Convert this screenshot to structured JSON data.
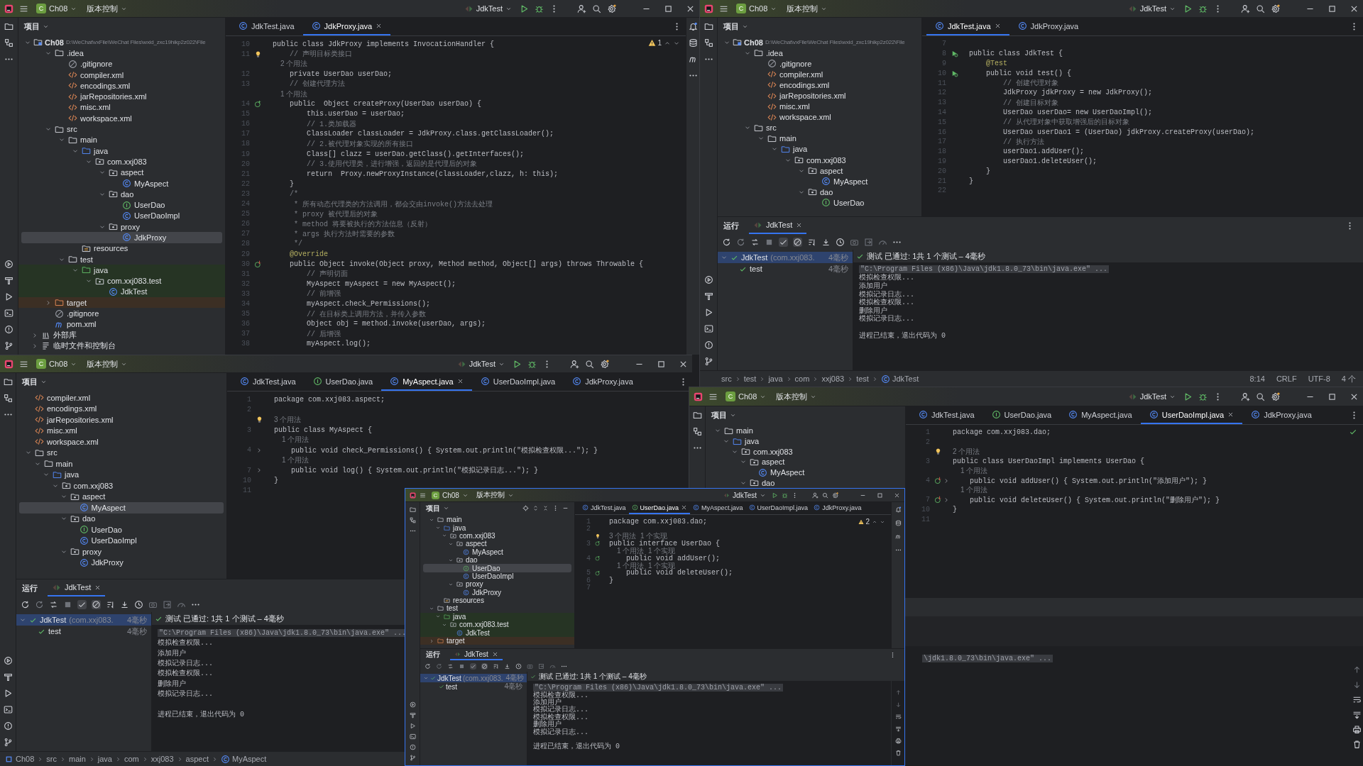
{
  "windows": [
    {
      "title_bar": {
        "badge": "C",
        "project": "Ch08",
        "vcs": "版本控制",
        "run_config": "JdkTest"
      },
      "project_pane": {
        "title": "项目",
        "tree": [
          {
            "label": "Ch08",
            "kind": "module",
            "path": "D:\\WeChat\\vxFile\\WeChat Files\\wxid_zxc19hikp2z022\\File",
            "expanded": true,
            "selected": false,
            "children": [
              {
                "label": ".idea",
                "kind": "folder",
                "expanded": true,
                "selected": false,
                "children": [
                  {
                    "label": ".gitignore",
                    "kind": "ignore",
                    "selected": false
                  },
                  {
                    "label": "compiler.xml",
                    "kind": "xml",
                    "selected": false
                  },
                  {
                    "label": "encodings.xml",
                    "kind": "xml",
                    "selected": false
                  },
                  {
                    "label": "jarRepositories.xml",
                    "kind": "xml",
                    "selected": false
                  },
                  {
                    "label": "misc.xml",
                    "kind": "xml",
                    "selected": false
                  },
                  {
                    "label": "workspace.xml",
                    "kind": "xml",
                    "selected": false
                  }
                ]
              },
              {
                "label": "src",
                "kind": "folder",
                "expanded": true,
                "selected": false,
                "children": [
                  {
                    "label": "main",
                    "kind": "folder",
                    "expanded": true,
                    "selected": false,
                    "children": [
                      {
                        "label": "java",
                        "kind": "source",
                        "expanded": true,
                        "selected": false,
                        "children": [
                          {
                            "label": "com.xxj083",
                            "kind": "package",
                            "expanded": true,
                            "selected": false,
                            "children": [
                              {
                                "label": "aspect",
                                "kind": "package",
                                "expanded": true,
                                "selected": false,
                                "children": [
                                  {
                                    "label": "MyAspect",
                                    "kind": "class",
                                    "selected": false
                                  }
                                ]
                              },
                              {
                                "label": "dao",
                                "kind": "package",
                                "expanded": true,
                                "selected": false,
                                "children": [
                                  {
                                    "label": "UserDao",
                                    "kind": "interface",
                                    "selected": false
                                  },
                                  {
                                    "label": "UserDaoImpl",
                                    "kind": "class",
                                    "selected": false
                                  }
                                ]
                              },
                              {
                                "label": "proxy",
                                "kind": "package",
                                "expanded": true,
                                "selected": false,
                                "children": [
                                  {
                                    "label": "JdkProxy",
                                    "kind": "class",
                                    "selected": true
                                  }
                                ]
                              }
                            ]
                          }
                        ]
                      },
                      {
                        "label": "resources",
                        "kind": "resources",
                        "selected": false
                      }
                    ]
                  },
                  {
                    "label": "test",
                    "kind": "folder",
                    "expanded": true,
                    "selected": false,
                    "children": [
                      {
                        "label": "java",
                        "kind": "test_source",
                        "expanded": true,
                        "selected": false,
                        "children": [
                          {
                            "label": "com.xxj083.test",
                            "kind": "package",
                            "expanded": true,
                            "selected": false,
                            "children": [
                              {
                                "label": "JdkTest",
                                "kind": "class",
                                "selected": false
                              }
                            ]
                          }
                        ]
                      }
                    ]
                  }
                ]
              },
              {
                "label": "target",
                "kind": "excluded",
                "expanded": false,
                "selected": false
              },
              {
                "label": ".gitignore",
                "kind": "ignore",
                "selected": false
              },
              {
                "label": "pom.xml",
                "kind": "maven",
                "selected": false
              }
            ]
          },
          {
            "label": "外部库",
            "kind": "library",
            "expanded": false,
            "selected": false
          },
          {
            "label": "临时文件和控制台",
            "kind": "scratch",
            "expanded": false,
            "selected": false
          }
        ]
      },
      "editor": {
        "tabs": [
          {
            "label": "JdkTest.java",
            "kind": "class",
            "selected": false
          },
          {
            "label": "JdkProxy.java",
            "kind": "class",
            "selected": true
          }
        ],
        "inspection": {
          "kind": "warning",
          "count": "1"
        },
        "lines": [
          {
            "number": "10",
            "kind": "code",
            "text": "public class JdkProxy implements InvocationHandler {"
          },
          {
            "number": "11",
            "kind": "comment",
            "text": "    // 声明目标类接口",
            "gutter": {
              "kind": "bulb"
            }
          },
          {
            "kind": "hint",
            "text": "    2 个用法"
          },
          {
            "number": "12",
            "kind": "code",
            "text": "    private UserDao userDao;"
          },
          {
            "number": "13",
            "kind": "comment",
            "text": "    // 创建代理方法"
          },
          {
            "kind": "hint",
            "text": "    1 个用法"
          },
          {
            "number": "14",
            "kind": "code",
            "text": "    public  Object createProxy(UserDao userDao) {",
            "gutter": {
              "kind": "implemented"
            }
          },
          {
            "number": "15",
            "kind": "code",
            "text": "        this.userDao = userDao;"
          },
          {
            "number": "16",
            "kind": "comment",
            "text": "        // 1.类加载器"
          },
          {
            "number": "17",
            "kind": "code",
            "text": "        ClassLoader classLoader = JdkProxy.class.getClassLoader();"
          },
          {
            "number": "18",
            "kind": "comment",
            "text": "        // 2.被代理对象实现的所有接口"
          },
          {
            "number": "19",
            "kind": "code",
            "text": "        Class[] clazz = userDao.getClass().getInterfaces();"
          },
          {
            "number": "20",
            "kind": "comment",
            "text": "        // 3.使用代理类，进行增强，返回的是代理后的对象"
          },
          {
            "number": "21",
            "kind": "code",
            "text": "        return  Proxy.newProxyInstance(classLoader,clazz, h: this);"
          },
          {
            "number": "22",
            "kind": "code",
            "text": "    }"
          },
          {
            "number": "23",
            "kind": "comment",
            "text": "    /*"
          },
          {
            "number": "24",
            "kind": "comment",
            "text": "     * 所有动态代理类的方法调用，都会交由invoke()方法去处理"
          },
          {
            "number": "25",
            "kind": "comment",
            "text": "     * proxy 被代理后的对象"
          },
          {
            "number": "26",
            "kind": "comment",
            "text": "     * method 将要被执行的方法信息（反射）"
          },
          {
            "number": "27",
            "kind": "comment",
            "text": "     * args 执行方法时需要的参数"
          },
          {
            "number": "28",
            "kind": "comment",
            "text": "     */"
          },
          {
            "number": "29",
            "kind": "annotation",
            "text": "    @Override"
          },
          {
            "number": "30",
            "kind": "code",
            "text": "    public Object invoke(Object proxy, Method method, Object[] args) throws Throwable {",
            "gutter": {
              "kind": "overriding"
            }
          },
          {
            "number": "31",
            "kind": "comment",
            "text": "        // 声明切面"
          },
          {
            "number": "32",
            "kind": "code",
            "text": "        MyAspect myAspect = new MyAspect();"
          },
          {
            "number": "33",
            "kind": "comment",
            "text": "        // 前增强"
          },
          {
            "number": "34",
            "kind": "code",
            "text": "        myAspect.check_Permissions();"
          },
          {
            "number": "35",
            "kind": "comment",
            "text": "        // 在目标类上调用方法，并传入参数"
          },
          {
            "number": "36",
            "kind": "code",
            "text": "        Object obj = method.invoke(userDao, args);"
          },
          {
            "number": "37",
            "kind": "comment",
            "text": "        // 后增强"
          },
          {
            "number": "38",
            "kind": "code",
            "text": "        myAspect.log();"
          }
        ]
      }
    },
    {
      "title_bar": {
        "badge": "C",
        "project": "Ch08",
        "vcs": "版本控制",
        "run_config": "JdkTest"
      },
      "project_pane": {
        "title": "项目",
        "tree": [
          {
            "label": "Ch08",
            "kind": "module",
            "path": "D:\\WeChat\\vxFile\\WeChat Files\\wxid_zxc19hikp2z022\\File",
            "expanded": true,
            "selected": false,
            "children": [
              {
                "label": ".idea",
                "kind": "folder",
                "expanded": true,
                "selected": false,
                "children": [
                  {
                    "label": ".gitignore",
                    "kind": "ignore",
                    "selected": false
                  },
                  {
                    "label": "compiler.xml",
                    "kind": "xml",
                    "selected": false
                  },
                  {
                    "label": "encodings.xml",
                    "kind": "xml",
                    "selected": false
                  },
                  {
                    "label": "jarRepositories.xml",
                    "kind": "xml",
                    "selected": false
                  },
                  {
                    "label": "misc.xml",
                    "kind": "xml",
                    "selected": false
                  },
                  {
                    "label": "workspace.xml",
                    "kind": "xml",
                    "selected": false
                  }
                ]
              },
              {
                "label": "src",
                "kind": "folder",
                "expanded": true,
                "selected": false,
                "children": [
                  {
                    "label": "main",
                    "kind": "folder",
                    "expanded": true,
                    "selected": false,
                    "children": [
                      {
                        "label": "java",
                        "kind": "source",
                        "expanded": true,
                        "selected": false,
                        "children": [
                          {
                            "label": "com.xxj083",
                            "kind": "package",
                            "expanded": true,
                            "selected": false,
                            "children": [
                              {
                                "label": "aspect",
                                "kind": "package",
                                "expanded": true,
                                "selected": false,
                                "children": [
                                  {
                                    "label": "MyAspect",
                                    "kind": "class",
                                    "selected": false
                                  }
                                ]
                              },
                              {
                                "label": "dao",
                                "kind": "package",
                                "expanded": true,
                                "selected": false,
                                "children": [
                                  {
                                    "label": "UserDao",
                                    "kind": "interface",
                                    "selected": false
                                  }
                                ]
                              }
                            ]
                          }
                        ]
                      }
                    ]
                  }
                ]
              }
            ]
          }
        ]
      },
      "editor": {
        "tabs": [
          {
            "label": "JdkTest.java",
            "kind": "class",
            "selected": true
          },
          {
            "label": "JdkProxy.java",
            "kind": "class",
            "selected": false
          }
        ],
        "lines": [
          {
            "number": "7",
            "kind": "code"
          },
          {
            "number": "8",
            "kind": "code",
            "text": "public class JdkTest {",
            "gutter": {
              "kind": "run"
            }
          },
          {
            "number": "9",
            "kind": "annotation",
            "text": "    @Test"
          },
          {
            "number": "10",
            "kind": "code",
            "text": "    public void test() {",
            "gutter": {
              "kind": "run"
            }
          },
          {
            "number": "11",
            "kind": "comment",
            "text": "        // 创建代理对象"
          },
          {
            "number": "12",
            "kind": "code",
            "text": "        JdkProxy jdkProxy = new JdkProxy();"
          },
          {
            "number": "13",
            "kind": "comment",
            "text": "        // 创建目标对象"
          },
          {
            "number": "14",
            "kind": "code",
            "text": "        UserDao userDao= new UserDaoImpl();"
          },
          {
            "number": "15",
            "kind": "comment",
            "text": "        // 从代理对象中获取增强后的目标对象"
          },
          {
            "number": "16",
            "kind": "code",
            "text": "        UserDao userDao1 = (UserDao) jdkProxy.createProxy(userDao);"
          },
          {
            "number": "17",
            "kind": "comment",
            "text": "        // 执行方法"
          },
          {
            "number": "18",
            "kind": "code",
            "text": "        userDao1.addUser();"
          },
          {
            "number": "19",
            "kind": "code",
            "text": "        userDao1.deleteUser();"
          },
          {
            "number": "20",
            "kind": "code",
            "text": "    }"
          },
          {
            "number": "21",
            "kind": "code",
            "text": "}"
          },
          {
            "number": "22",
            "kind": "code"
          }
        ]
      },
      "run_panel": {
        "title": "运行",
        "tab": {
          "label": "JdkTest",
          "selected": true
        },
        "tests": [
          {
            "name": "JdkTest",
            "detail": "(com.xxj083.",
            "time": "4毫秒",
            "passed": true,
            "expanded": true,
            "children": [
              {
                "name": "test",
                "time": "4毫秒",
                "passed": true
              }
            ]
          }
        ],
        "summary": "测试 已通过: 1共 1 个测试 – 4毫秒",
        "console": [
          {
            "kind": "command",
            "text": "\"C:\\Program Files (x86)\\Java\\jdk1.8.0_73\\bin\\java.exe\" ..."
          },
          {
            "kind": "output",
            "text": "模拟检查权限..."
          },
          {
            "kind": "output",
            "text": "添加用户"
          },
          {
            "kind": "output",
            "text": "模拟记录日志..."
          },
          {
            "kind": "output",
            "text": "模拟检查权限..."
          },
          {
            "kind": "output",
            "text": "删除用户"
          },
          {
            "kind": "output",
            "text": "模拟记录日志..."
          },
          {
            "kind": "exit",
            "text": "进程已结束，退出代码为 0"
          }
        ]
      },
      "status_bar": {
        "breadcrumbs": [
          {
            "label": "src",
            "kind": "folder"
          },
          {
            "label": "test",
            "kind": "folder"
          },
          {
            "label": "java",
            "kind": "folder"
          },
          {
            "label": "com",
            "kind": "folder"
          },
          {
            "label": "xxj083",
            "kind": "folder"
          },
          {
            "label": "test",
            "kind": "folder"
          },
          {
            "label": "JdkTest",
            "kind": "class"
          }
        ],
        "items": [
          "8:14",
          "CRLF",
          "UTF-8",
          "4 个"
        ]
      }
    },
    {
      "title_bar": {
        "badge": "C",
        "project": "Ch08",
        "vcs": "版本控制",
        "run_config": "JdkTest"
      },
      "project_pane": {
        "title": "项目",
        "tree": [
          {
            "label": "compiler.xml",
            "kind": "xml",
            "selected": false
          },
          {
            "label": "encodings.xml",
            "kind": "xml",
            "selected": false
          },
          {
            "label": "jarRepositories.xml",
            "kind": "xml",
            "selected": false
          },
          {
            "label": "misc.xml",
            "kind": "xml",
            "selected": false
          },
          {
            "label": "workspace.xml",
            "kind": "xml",
            "selected": false
          },
          {
            "label": "src",
            "kind": "folder",
            "expanded": true,
            "selected": false,
            "children": [
              {
                "label": "main",
                "kind": "folder",
                "expanded": true,
                "selected": false,
                "children": [
                  {
                    "label": "java",
                    "kind": "source",
                    "expanded": true,
                    "selected": false,
                    "children": [
                      {
                        "label": "com.xxj083",
                        "kind": "package",
                        "expanded": true,
                        "selected": false,
                        "children": [
                          {
                            "label": "aspect",
                            "kind": "package",
                            "expanded": true,
                            "selected": false,
                            "children": [
                              {
                                "label": "MyAspect",
                                "kind": "class",
                                "selected": true
                              }
                            ]
                          },
                          {
                            "label": "dao",
                            "kind": "package",
                            "expanded": true,
                            "selected": false,
                            "children": [
                              {
                                "label": "UserDao",
                                "kind": "interface",
                                "selected": false
                              },
                              {
                                "label": "UserDaoImpl",
                                "kind": "class",
                                "selected": false
                              }
                            ]
                          },
                          {
                            "label": "proxy",
                            "kind": "package",
                            "expanded": true,
                            "selected": false,
                            "children": [
                              {
                                "label": "JdkProxy",
                                "kind": "class",
                                "selected": false
                              }
                            ]
                          }
                        ]
                      }
                    ]
                  }
                ]
              }
            ]
          }
        ]
      },
      "editor": {
        "tabs": [
          {
            "label": "JdkTest.java",
            "kind": "class",
            "selected": false
          },
          {
            "label": "UserDao.java",
            "kind": "interface",
            "selected": false
          },
          {
            "label": "MyAspect.java",
            "kind": "class",
            "selected": true
          },
          {
            "label": "UserDaoImpl.java",
            "kind": "class",
            "selected": false
          },
          {
            "label": "JdkProxy.java",
            "kind": "class",
            "selected": false
          }
        ],
        "lines": [
          {
            "number": "1",
            "kind": "code",
            "text": "package com.xxj083.aspect;",
            "folded": false
          },
          {
            "number": "2",
            "kind": "code",
            "folded": false
          },
          {
            "kind": "hint",
            "text": "3 个用法",
            "gutter": {
              "kind": "bulb"
            },
            "folded": false
          },
          {
            "number": "3",
            "kind": "code",
            "text": "public class MyAspect {",
            "folded": false
          },
          {
            "kind": "hint",
            "text": "    1 个用法",
            "folded": false
          },
          {
            "number": "4",
            "kind": "code",
            "text": "    public void check_Permissions() { System.out.println(\"模拟检查权限...\"); }",
            "folded": true
          },
          {
            "kind": "hint",
            "text": "    1 个用法",
            "folded": false
          },
          {
            "number": "7",
            "kind": "code",
            "text": "    public void log() { System.out.println(\"模拟记录日志...\"); }",
            "folded": true
          },
          {
            "number": "10",
            "kind": "code",
            "text": "}",
            "folded": false
          },
          {
            "number": "11",
            "kind": "code",
            "folded": false
          }
        ]
      },
      "run_panel": {
        "title": "运行",
        "tab": {
          "label": "JdkTest",
          "selected": true
        },
        "tests": [
          {
            "name": "JdkTest",
            "detail": "(com.xxj083.",
            "time": "4毫秒",
            "passed": true,
            "expanded": true,
            "children": [
              {
                "name": "test",
                "time": "4毫秒",
                "passed": true
              }
            ]
          }
        ],
        "summary": "测试 已通过: 1共 1 个测试 – 4毫秒",
        "console": [
          {
            "kind": "command",
            "text": "\"C:\\Program Files (x86)\\Java\\jdk1.8.0_73\\bin\\java.exe\" ..."
          },
          {
            "kind": "output",
            "text": "模拟检查权限..."
          },
          {
            "kind": "output",
            "text": "添加用户"
          },
          {
            "kind": "output",
            "text": "模拟记录日志..."
          },
          {
            "kind": "output",
            "text": "模拟检查权限..."
          },
          {
            "kind": "output",
            "text": "删除用户"
          },
          {
            "kind": "output",
            "text": "模拟记录日志..."
          },
          {
            "kind": "exit",
            "text": "进程已结束，退出代码为 0"
          }
        ]
      },
      "status_bar": {
        "breadcrumbs": [
          {
            "label": "Ch08",
            "kind": "module"
          },
          {
            "label": "src",
            "kind": "folder"
          },
          {
            "label": "main",
            "kind": "folder"
          },
          {
            "label": "java",
            "kind": "folder"
          },
          {
            "label": "com",
            "kind": "folder"
          },
          {
            "label": "xxj083",
            "kind": "folder"
          },
          {
            "label": "aspect",
            "kind": "folder"
          },
          {
            "label": "MyAspect",
            "kind": "class"
          }
        ]
      }
    },
    {
      "title_bar": {
        "badge": "C",
        "project": "Ch08",
        "vcs": "版本控制",
        "run_config": "JdkTest"
      },
      "project_pane": {
        "title": "项目",
        "tree": [
          {
            "label": "main",
            "kind": "folder",
            "expanded": true,
            "selected": false,
            "children": [
              {
                "label": "java",
                "kind": "source",
                "expanded": true,
                "selected": false,
                "children": [
                  {
                    "label": "com.xxj083",
                    "kind": "package",
                    "expanded": true,
                    "selected": false,
                    "children": [
                      {
                        "label": "aspect",
                        "kind": "package",
                        "expanded": true,
                        "selected": false,
                        "children": [
                          {
                            "label": "MyAspect",
                            "kind": "class",
                            "selected": false
                          }
                        ]
                      },
                      {
                        "label": "dao",
                        "kind": "package",
                        "expanded": true,
                        "selected": false
                      }
                    ]
                  }
                ]
              }
            ]
          }
        ]
      },
      "editor": {
        "tabs": [
          {
            "label": "JdkTest.java",
            "kind": "class",
            "selected": false
          },
          {
            "label": "UserDao.java",
            "kind": "interface",
            "selected": false
          },
          {
            "label": "MyAspect.java",
            "kind": "class",
            "selected": false
          },
          {
            "label": "UserDaoImpl.java",
            "kind": "class",
            "selected": true
          },
          {
            "label": "JdkProxy.java",
            "kind": "class",
            "selected": false
          }
        ],
        "inspection": {
          "kind": "ok"
        },
        "lines": [
          {
            "number": "1",
            "kind": "code",
            "text": "package com.xxj083.dao;",
            "folded": false
          },
          {
            "number": "2",
            "kind": "code",
            "folded": false
          },
          {
            "kind": "hint",
            "text": "2 个用法",
            "gutter": {
              "kind": "bulb"
            },
            "folded": false
          },
          {
            "number": "3",
            "kind": "code",
            "text": "public class UserDaoImpl implements UserDao {",
            "folded": false
          },
          {
            "kind": "hint",
            "text": "    1 个用法",
            "folded": false
          },
          {
            "number": "4",
            "kind": "code",
            "text": "    public void addUser() { System.out.println(\"添加用户\"); }",
            "gutter": {
              "kind": "overriding"
            },
            "folded": true
          },
          {
            "kind": "hint",
            "text": "    1 个用法",
            "folded": false
          },
          {
            "number": "7",
            "kind": "code",
            "text": "    public void deleteUser() { System.out.println(\"删除用户\"); }",
            "gutter": {
              "kind": "overriding"
            },
            "folded": true
          },
          {
            "number": "10",
            "kind": "code",
            "text": "}",
            "folded": false
          },
          {
            "number": "11",
            "kind": "code",
            "folded": false
          }
        ]
      },
      "run_panel": {
        "console": [
          {
            "kind": "command",
            "text": "\\jdk1.8.0_73\\bin\\java.exe\" ..."
          }
        ]
      }
    },
    {
      "title_bar": {
        "badge": "C",
        "project": "Ch08",
        "vcs": "版本控制",
        "run_config": "JdkTest"
      },
      "project_pane": {
        "title": "项目",
        "tree": [
          {
            "label": "main",
            "kind": "folder",
            "expanded": true,
            "selected": false,
            "children": [
              {
                "label": "java",
                "kind": "source",
                "expanded": true,
                "selected": false,
                "children": [
                  {
                    "label": "com.xxj083",
                    "kind": "package",
                    "expanded": true,
                    "selected": false,
                    "children": [
                      {
                        "label": "aspect",
                        "kind": "package",
                        "expanded": true,
                        "selected": false,
                        "children": [
                          {
                            "label": "MyAspect",
                            "kind": "class",
                            "selected": false
                          }
                        ]
                      },
                      {
                        "label": "dao",
                        "kind": "package",
                        "expanded": true,
                        "selected": false,
                        "children": [
                          {
                            "label": "UserDao",
                            "kind": "interface",
                            "selected": true
                          },
                          {
                            "label": "UserDaoImpl",
                            "kind": "class",
                            "selected": false
                          }
                        ]
                      },
                      {
                        "label": "proxy",
                        "kind": "package",
                        "expanded": true,
                        "selected": false,
                        "children": [
                          {
                            "label": "JdkProxy",
                            "kind": "class",
                            "selected": false
                          }
                        ]
                      }
                    ]
                  }
                ]
              },
              {
                "label": "resources",
                "kind": "resources",
                "selected": false
              }
            ]
          },
          {
            "label": "test",
            "kind": "folder",
            "expanded": true,
            "selected": false,
            "children": [
              {
                "label": "java",
                "kind": "test_source",
                "expanded": true,
                "selected": false,
                "children": [
                  {
                    "label": "com.xxj083.test",
                    "kind": "package",
                    "expanded": true,
                    "selected": false,
                    "children": [
                      {
                        "label": "JdkTest",
                        "kind": "class",
                        "selected": false
                      }
                    ]
                  }
                ]
              }
            ]
          },
          {
            "label": "target",
            "kind": "excluded",
            "expanded": false,
            "selected": false
          }
        ]
      },
      "editor": {
        "tabs": [
          {
            "label": "JdkTest.java",
            "kind": "class",
            "selected": false
          },
          {
            "label": "UserDao.java",
            "kind": "interface",
            "selected": true
          },
          {
            "label": "MyAspect.java",
            "kind": "class",
            "selected": false
          },
          {
            "label": "UserDaoImpl.java",
            "kind": "class",
            "selected": false
          },
          {
            "label": "JdkProxy.java",
            "kind": "class",
            "selected": false
          }
        ],
        "inspection": {
          "kind": "warning",
          "count": "2"
        },
        "lines": [
          {
            "number": "1",
            "kind": "code",
            "text": "package com.xxj083.dao;"
          },
          {
            "number": "2",
            "kind": "code"
          },
          {
            "kind": "hint",
            "text": "3 个用法  1 个实现",
            "gutter": {
              "kind": "bulb"
            }
          },
          {
            "number": "3",
            "kind": "code",
            "text": "public interface UserDao {",
            "gutter": {
              "kind": "implemented"
            }
          },
          {
            "kind": "hint",
            "text": "    1 个用法  1 个实现"
          },
          {
            "number": "4",
            "kind": "code",
            "text": "    public void addUser();",
            "gutter": {
              "kind": "implemented"
            }
          },
          {
            "kind": "hint",
            "text": "    1 个用法  1 个实现"
          },
          {
            "number": "5",
            "kind": "code",
            "text": "    public void deleteUser();",
            "gutter": {
              "kind": "implemented"
            }
          },
          {
            "number": "6",
            "kind": "code",
            "text": "}"
          },
          {
            "number": "7",
            "kind": "code"
          }
        ]
      },
      "run_panel": {
        "title": "运行",
        "tab": {
          "label": "JdkTest",
          "selected": true
        },
        "tests": [
          {
            "name": "JdkTest",
            "detail": "(com.xxj083.",
            "time": "4毫秒",
            "passed": true,
            "expanded": true,
            "children": [
              {
                "name": "test",
                "time": "4毫秒",
                "passed": true
              }
            ]
          }
        ],
        "summary": "测试 已通过: 1共 1 个测试 – 4毫秒",
        "console": [
          {
            "kind": "command",
            "text": "\"C:\\Program Files (x86)\\Java\\jdk1.8.0_73\\bin\\java.exe\" ..."
          },
          {
            "kind": "output",
            "text": "模拟检查权限..."
          },
          {
            "kind": "output",
            "text": "添加用户"
          },
          {
            "kind": "output",
            "text": "模拟记录日志..."
          },
          {
            "kind": "output",
            "text": "模拟检查权限..."
          },
          {
            "kind": "output",
            "text": "删除用户"
          },
          {
            "kind": "output",
            "text": "模拟记录日志..."
          },
          {
            "kind": "exit",
            "text": "进程已结束，退出代码为 0"
          }
        ]
      }
    }
  ]
}
